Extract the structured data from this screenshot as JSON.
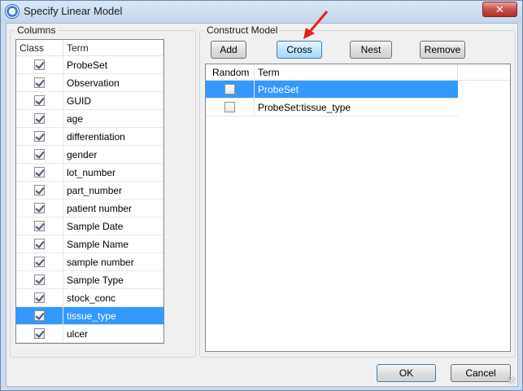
{
  "window": {
    "title": "Specify Linear Model",
    "close_glyph": "✕"
  },
  "columns": {
    "legend": "Columns",
    "header_class": "Class",
    "header_term": "Term",
    "rows": [
      {
        "term": "ProbeSet",
        "checked": true
      },
      {
        "term": "Observation",
        "checked": true
      },
      {
        "term": "GUID",
        "checked": true
      },
      {
        "term": "age",
        "checked": true
      },
      {
        "term": "differentiation",
        "checked": true
      },
      {
        "term": "gender",
        "checked": true
      },
      {
        "term": "lot_number",
        "checked": true
      },
      {
        "term": "part_number",
        "checked": true
      },
      {
        "term": "patient number",
        "checked": true
      },
      {
        "term": "Sample Date",
        "checked": true
      },
      {
        "term": "Sample Name",
        "checked": true
      },
      {
        "term": "sample number",
        "checked": true
      },
      {
        "term": "Sample Type",
        "checked": true
      },
      {
        "term": "stock_conc",
        "checked": true
      },
      {
        "term": "tissue_type",
        "checked": true,
        "selected": true
      },
      {
        "term": "ulcer",
        "checked": true
      }
    ]
  },
  "model": {
    "legend": "Construct Model",
    "buttons": {
      "add": "Add",
      "cross": "Cross",
      "nest": "Nest",
      "remove": "Remove"
    },
    "header_random": "Random",
    "header_term": "Term",
    "rows": [
      {
        "term": "ProbeSet",
        "random": false,
        "selected": true
      },
      {
        "term": "ProbeSet:tissue_type",
        "random": false
      }
    ]
  },
  "dialog": {
    "ok": "OK",
    "cancel": "Cancel"
  },
  "colors": {
    "selection": "#3399ff",
    "arrow": "#e8201f"
  }
}
